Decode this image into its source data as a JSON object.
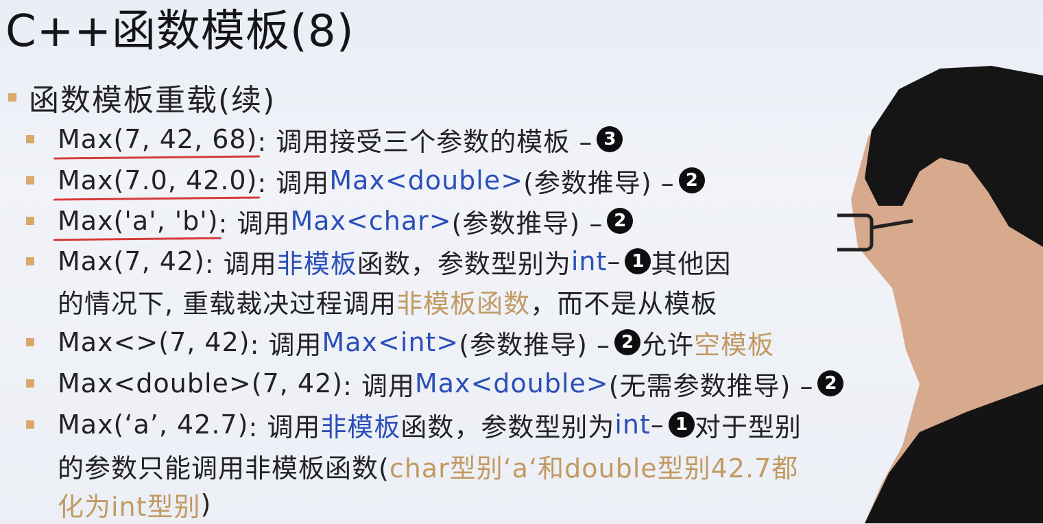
{
  "title": "C++函数模板(8)",
  "section": "函数模板重载(续)",
  "items": [
    {
      "code": "Max(7, 42, 68)",
      "a": ": 调用接受三个参数的模板 – ",
      "num": "3"
    },
    {
      "code": "Max(7.0, 42.0)",
      "a": ": 调用",
      "b": "Max<double>",
      "c": " (参数推导) – ",
      "num": "2"
    },
    {
      "code": "Max('a', 'b')",
      "a": ": 调用",
      "b": "Max<char>",
      "c": " (参数推导) – ",
      "num": "2"
    },
    {
      "code": "Max(7, 42)",
      "a": ": 调用 ",
      "b": "非模板",
      "c": "函数，参数型别为",
      "d": "int",
      "e": " – ",
      "num": "1",
      "f": " 其他因",
      "cont_a": "的情况下, 重载裁决过程调用",
      "cont_b": "非模板函数",
      "cont_c": "，而不是从模板"
    },
    {
      "code": "Max<>(7, 42)",
      "a": ": 调用",
      "b": "Max<int>",
      "c": " (参数推导) – ",
      "num": "2",
      "f": " 允许",
      "g": "空模板"
    },
    {
      "code": "Max<double>(7, 42)",
      "a": ": 调用",
      "b": "Max<double>",
      "c": " (无需参数推导) – ",
      "num": "2"
    },
    {
      "code": "Max(‘a’, 42.7)",
      "a": ": 调用 ",
      "b": "非模板",
      "c": "函数，参数型别为",
      "d": "int",
      "e": " – ",
      "num": "1",
      "f": " 对于型别",
      "cont_a": "的参数只能调用非模板函数(",
      "cont_b": "char型别‘a‘和double型别42.7都",
      "cont2_b": "化为int型别",
      "cont2_c": ")"
    }
  ],
  "colors": {
    "blue": "#2a4fb8",
    "orange": "#c19a62",
    "bullet": "#d9a86a",
    "underline": "#d63a3a"
  }
}
